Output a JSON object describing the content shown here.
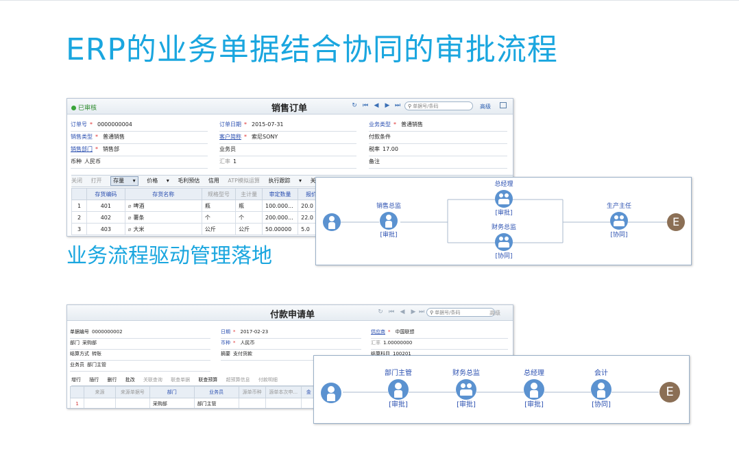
{
  "title": "ERP的业务单据结合协同的审批流程",
  "subtitle": "业务流程驱动管理落地",
  "sales_order": {
    "status": "已审核",
    "title": "销售订单",
    "search_placeholder": "单据号/条码",
    "hl_label": "高级",
    "fields": [
      {
        "label": "订单号",
        "req": true,
        "value": "0000000004",
        "style": "blue"
      },
      {
        "label": "订单日期",
        "req": true,
        "value": "2015-07-31",
        "style": "blue"
      },
      {
        "label": "业务类型",
        "req": true,
        "value": "普通销售",
        "style": "blue"
      },
      {
        "label": "销售类型",
        "req": true,
        "value": "普通销售",
        "style": "blue"
      },
      {
        "label": "客户简称",
        "req": true,
        "value": "索尼SONY",
        "style": "link"
      },
      {
        "label": "付款条件",
        "req": false,
        "value": "",
        "style": "plain"
      },
      {
        "label": "销售部门",
        "req": true,
        "value": "销售部",
        "style": "link"
      },
      {
        "label": "业务员",
        "req": false,
        "value": "",
        "style": "plain"
      },
      {
        "label": "税率",
        "req": false,
        "value": "17.00",
        "style": "plain"
      },
      {
        "label": "币种",
        "req": false,
        "value": "人民币",
        "style": "plain"
      },
      {
        "label": "汇率",
        "req": false,
        "value": "1",
        "style": "gray"
      },
      {
        "label": "备注",
        "req": false,
        "value": "",
        "style": "plain"
      }
    ],
    "toolbar": [
      "关闭",
      "打开",
      "存量",
      "价格",
      "毛利预估",
      "信用",
      "ATP模拟运算",
      "执行跟踪",
      "关"
    ],
    "columns": [
      "",
      "存货编码",
      "存货名称",
      "规格型号",
      "主计量",
      "审定数量",
      "报价"
    ],
    "rows": [
      [
        "1",
        "401",
        "啤酒",
        "瓶",
        "瓶",
        "100.000...",
        "20.0"
      ],
      [
        "2",
        "402",
        "薯条",
        "个",
        "个",
        "200.000...",
        "22.0"
      ],
      [
        "3",
        "403",
        "大米",
        "公斤",
        "公斤",
        "50.00000",
        "5.0"
      ]
    ]
  },
  "payment_request": {
    "title": "付款申请单",
    "search_placeholder": "单据号/条码",
    "hl_label": "高级",
    "fields": [
      {
        "label": "单据编号",
        "req": false,
        "value": "0000000002",
        "style": "plain"
      },
      {
        "label": "日期",
        "req": true,
        "value": "2017-02-23",
        "style": "blue"
      },
      {
        "label": "供应商",
        "req": true,
        "value": "中国联想",
        "style": "link"
      },
      {
        "label": "部门",
        "req": false,
        "value": "采购部",
        "style": "plain"
      },
      {
        "label": "币种",
        "req": true,
        "value": "人民币",
        "style": "blue"
      },
      {
        "label": "汇率",
        "req": false,
        "value": "1.00000000",
        "style": "gray"
      },
      {
        "label": "结算方式",
        "req": false,
        "value": "转账",
        "style": "plain"
      },
      {
        "label": "摘要",
        "req": false,
        "value": "支付货款",
        "style": "plain"
      },
      {
        "label": "结算科目",
        "req": false,
        "value": "100201",
        "style": "plain"
      },
      {
        "label": "业务员",
        "req": false,
        "value": "部门主管",
        "style": "plain"
      }
    ],
    "toolbar": [
      "增行",
      "插行",
      "删行",
      "批改",
      "关联查询",
      "联查单据",
      "联查预算",
      "超预算信息",
      "付款明细"
    ],
    "columns": [
      "",
      "来源",
      "来源单据号",
      "部门",
      "业务员",
      "源单币种",
      "源单本次申...",
      "金"
    ],
    "rows": [
      [
        "1",
        "",
        "",
        "采购部",
        "部门主管",
        "",
        "",
        ""
      ]
    ]
  },
  "flow1": {
    "start_icon": "person-icon",
    "nodes": [
      {
        "label": "销售总监",
        "action": "[审批]",
        "icon": "person-icon"
      },
      {
        "label": "总经理",
        "action": "[审批]",
        "icon": "group-icon"
      },
      {
        "label": "财务总监",
        "action": "[协同]",
        "icon": "group-icon"
      },
      {
        "label": "生产主任",
        "action": "[协同]",
        "icon": "group-icon"
      }
    ],
    "end_label": "E"
  },
  "flow2": {
    "start_icon": "person-icon",
    "nodes": [
      {
        "label": "部门主管",
        "action": "[审批]",
        "icon": "person-icon"
      },
      {
        "label": "财务总监",
        "action": "[审批]",
        "icon": "group-icon"
      },
      {
        "label": "总经理",
        "action": "[审批]",
        "icon": "person-icon"
      },
      {
        "label": "会计",
        "action": "[协同]",
        "icon": "person-icon"
      }
    ],
    "end_label": "E"
  },
  "colors": {
    "title": "#1aa6df",
    "node": "#5b92d0",
    "end": "#8b6f55",
    "link": "#2a4fb0"
  }
}
